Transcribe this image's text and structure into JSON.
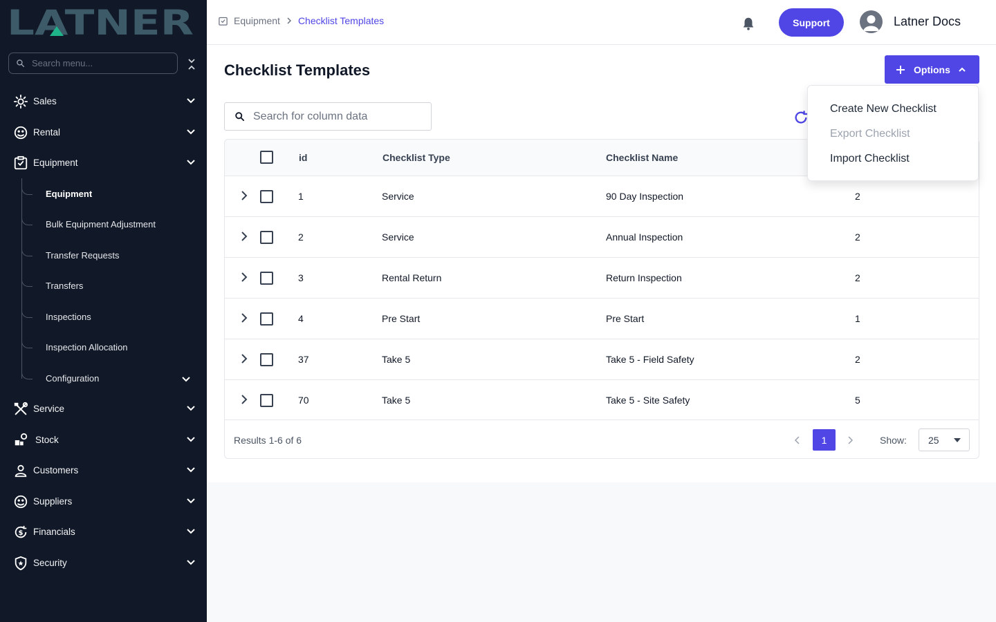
{
  "brand": {
    "logo_text": "LATNER",
    "logo_color": "#3c5a68",
    "accent_color": "#4f46e5"
  },
  "sidebar": {
    "search_placeholder": "Search menu...",
    "items": [
      {
        "label": "Sales",
        "icon": "sales-icon"
      },
      {
        "label": "Rental",
        "icon": "rental-icon"
      },
      {
        "label": "Equipment",
        "icon": "equipment-icon"
      },
      {
        "label": "Service",
        "icon": "service-icon"
      },
      {
        "label": "Stock",
        "icon": "stock-icon"
      },
      {
        "label": "Customers",
        "icon": "customers-icon"
      },
      {
        "label": "Suppliers",
        "icon": "suppliers-icon"
      },
      {
        "label": "Financials",
        "icon": "financials-icon"
      },
      {
        "label": "Security",
        "icon": "security-icon"
      }
    ],
    "equipment_sub": [
      {
        "label": "Equipment",
        "active": true
      },
      {
        "label": "Bulk Equipment Adjustment"
      },
      {
        "label": "Transfer Requests"
      },
      {
        "label": "Transfers"
      },
      {
        "label": "Inspections"
      },
      {
        "label": "Inspection Allocation"
      },
      {
        "label": "Configuration"
      }
    ]
  },
  "header": {
    "breadcrumb": [
      "Equipment",
      "Checklist Templates"
    ],
    "support_label": "Support",
    "user_name": "Latner Docs"
  },
  "main": {
    "title": "Checklist Templates",
    "options_label": "Options",
    "search_placeholder": "Search for column data",
    "columns": [
      "id",
      "Checklist Type",
      "Checklist Name"
    ],
    "rows": [
      {
        "id": "1",
        "type": "Service",
        "name": "90 Day Inspection",
        "count": "2"
      },
      {
        "id": "2",
        "type": "Service",
        "name": "Annual Inspection",
        "count": "2"
      },
      {
        "id": "3",
        "type": "Rental Return",
        "name": "Return Inspection",
        "count": "2"
      },
      {
        "id": "4",
        "type": "Pre Start",
        "name": "Pre Start",
        "count": "1"
      },
      {
        "id": "37",
        "type": "Take 5",
        "name": "Take 5 - Field Safety",
        "count": "2"
      },
      {
        "id": "70",
        "type": "Take 5",
        "name": "Take 5 - Site Safety",
        "count": "5"
      }
    ],
    "results_text": "Results 1-6 of 6",
    "current_page": "1",
    "show_label": "Show:",
    "page_size": "25"
  },
  "options_menu": [
    {
      "label": "Create New Checklist",
      "disabled": false
    },
    {
      "label": "Export Checklist",
      "disabled": true
    },
    {
      "label": "Import Checklist",
      "disabled": false
    }
  ]
}
